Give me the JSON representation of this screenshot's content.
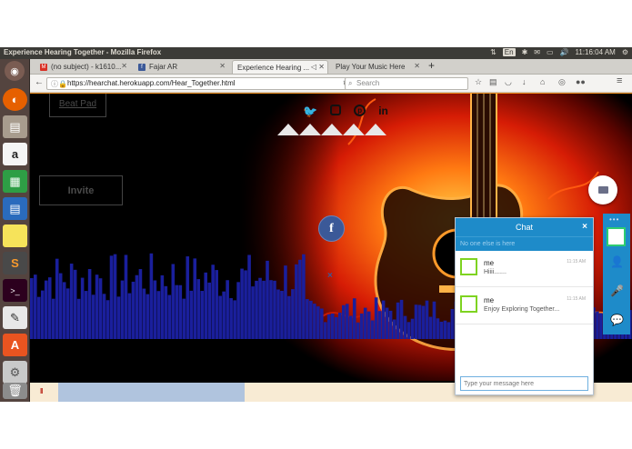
{
  "topbar": {
    "window_title": "Experience Hearing Together - Mozilla Firefox",
    "keyboard_layout": "En",
    "clock": "11:16:04 AM"
  },
  "tabs": [
    {
      "label": "(no subject) - k1610...",
      "icon": "gmail-icon",
      "color": "#d93025"
    },
    {
      "label": "Fajar AR",
      "icon": "facebook-icon",
      "color": "#3b5998"
    },
    {
      "label": "Experience Hearing ...",
      "icon": "none",
      "color": "#f4f3f1",
      "active": true
    },
    {
      "label": "Play Your Music Here",
      "icon": "none",
      "color": "#d2d0cb"
    }
  ],
  "nav": {
    "url": "https://hearchat.herokuapp.com/Hear_Together.html",
    "search_placeholder": "Search"
  },
  "page": {
    "beat_pad_label": "Beat Pad",
    "invite_label": "Invite",
    "facebook_label": "f",
    "close_label": "×",
    "social_icons": [
      "twitter-icon",
      "instagram-icon",
      "pinterest-icon",
      "linkedin-icon"
    ],
    "pause_label": "II",
    "progress_fraction": 0.31
  },
  "chat": {
    "title": "Chat",
    "close_label": "×",
    "status": "No one else is here",
    "messages": [
      {
        "sender": "me",
        "text": "Hiiii.......",
        "time": "11:15 AM"
      },
      {
        "sender": "me",
        "text": "Enjoy Exploring Together...",
        "time": "11:15 AM"
      }
    ],
    "input_placeholder": "Type your message here"
  },
  "colors": {
    "accent": "#1e8bc9",
    "visualizer": "#1a1f9c",
    "firefox_orange": "#f39322",
    "facebook": "#3b5998"
  }
}
